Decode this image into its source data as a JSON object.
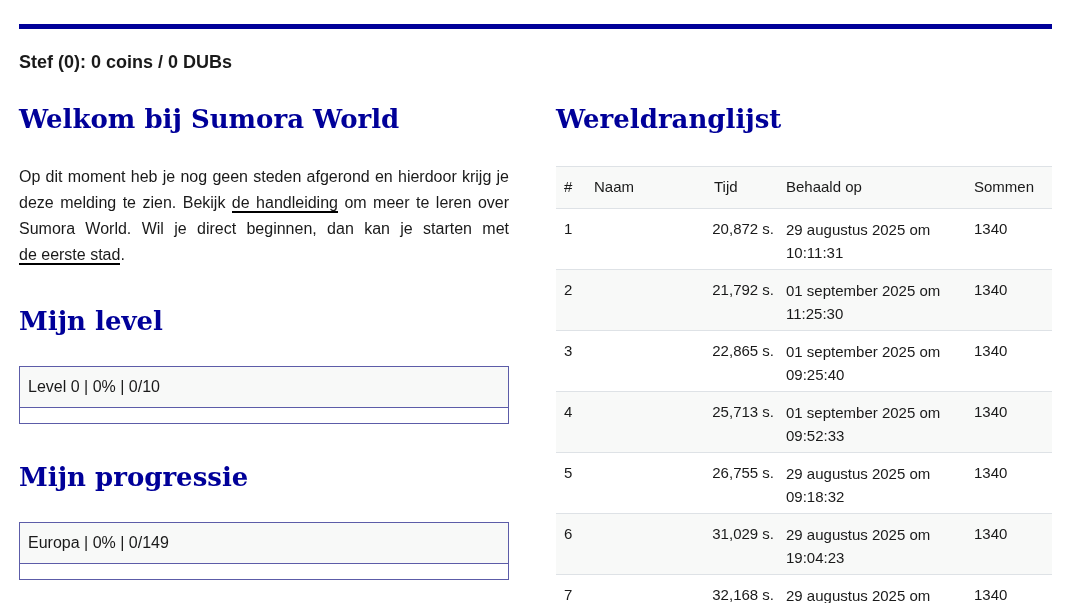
{
  "user_status": "Stef (0): 0 coins / 0 DUBs",
  "welcome": {
    "title": "Welkom bij Sumora World",
    "intro": [
      {
        "kind": "text",
        "text": "Op dit moment heb je nog geen steden afgerond en hierdoor krijg je deze melding te zien. Bekijk "
      },
      {
        "kind": "link",
        "text": "de handleiding"
      },
      {
        "kind": "text",
        "text": " om meer te leren over Sumora World. Wil je direct beginnen, dan kan je starten met "
      },
      {
        "kind": "link",
        "text": "de eerste stad"
      },
      {
        "kind": "text",
        "text": "."
      }
    ]
  },
  "level": {
    "title": "Mijn level",
    "bars": [
      {
        "label": "Level 0 | 0% | 0/10",
        "level": 0
      }
    ]
  },
  "progress": {
    "title": "Mijn progressie",
    "bars": [
      {
        "label": "Europa | 0% | 0/149",
        "level": 0
      }
    ]
  },
  "ranking": {
    "title": "Wereldranglijst",
    "columns": [
      "#",
      "Naam",
      "Tijd",
      "Behaald op",
      "Sommen"
    ],
    "rows": [
      {
        "rank": "1",
        "time": "20,872 s.",
        "date": "29 augustus 2025 om 10:11:31",
        "sums": "1340"
      },
      {
        "rank": "2",
        "time": "21,792 s.",
        "date": "01 september 2025 om 11:25:30",
        "sums": "1340"
      },
      {
        "rank": "3",
        "time": "22,865 s.",
        "date": "01 september 2025 om 09:25:40",
        "sums": "1340"
      },
      {
        "rank": "4",
        "time": "25,713 s.",
        "date": "01 september 2025 om 09:52:33",
        "sums": "1340"
      },
      {
        "rank": "5",
        "time": "26,755 s.",
        "date": "29 augustus 2025 om 09:18:32",
        "sums": "1340"
      },
      {
        "rank": "6",
        "time": "31,029 s.",
        "date": "29 augustus 2025 om 19:04:23",
        "sums": "1340"
      },
      {
        "rank": "7",
        "time": "32,168 s.",
        "date": "29 augustus 2025 om",
        "sums": "1340"
      }
    ]
  }
}
